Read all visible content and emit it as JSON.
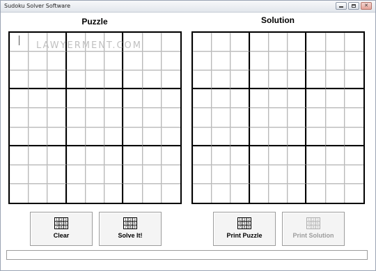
{
  "window": {
    "title": "Sudoku Solver Software",
    "controls": [
      "minimize-icon",
      "maximize-icon",
      "close-icon"
    ]
  },
  "puzzle": {
    "title": "Puzzle",
    "cells": [
      [
        "",
        "",
        "",
        "",
        "",
        "",
        "",
        "",
        ""
      ],
      [
        "",
        "",
        "",
        "",
        "",
        "",
        "",
        "",
        ""
      ],
      [
        "",
        "",
        "",
        "",
        "",
        "",
        "",
        "",
        ""
      ],
      [
        "",
        "",
        "",
        "",
        "",
        "",
        "",
        "",
        ""
      ],
      [
        "",
        "",
        "",
        "",
        "",
        "",
        "",
        "",
        ""
      ],
      [
        "",
        "",
        "",
        "",
        "",
        "",
        "",
        "",
        ""
      ],
      [
        "",
        "",
        "",
        "",
        "",
        "",
        "",
        "",
        ""
      ],
      [
        "",
        "",
        "",
        "",
        "",
        "",
        "",
        "",
        ""
      ],
      [
        "",
        "",
        "",
        "",
        "",
        "",
        "",
        "",
        ""
      ]
    ]
  },
  "solution": {
    "title": "Solution",
    "cells": [
      [
        "",
        "",
        "",
        "",
        "",
        "",
        "",
        "",
        ""
      ],
      [
        "",
        "",
        "",
        "",
        "",
        "",
        "",
        "",
        ""
      ],
      [
        "",
        "",
        "",
        "",
        "",
        "",
        "",
        "",
        ""
      ],
      [
        "",
        "",
        "",
        "",
        "",
        "",
        "",
        "",
        ""
      ],
      [
        "",
        "",
        "",
        "",
        "",
        "",
        "",
        "",
        ""
      ],
      [
        "",
        "",
        "",
        "",
        "",
        "",
        "",
        "",
        ""
      ],
      [
        "",
        "",
        "",
        "",
        "",
        "",
        "",
        "",
        ""
      ],
      [
        "",
        "",
        "",
        "",
        "",
        "",
        "",
        "",
        ""
      ],
      [
        "",
        "",
        "",
        "",
        "",
        "",
        "",
        "",
        ""
      ]
    ]
  },
  "watermark": "LAWYERMENT.COM",
  "buttons": {
    "clear": {
      "label": "Clear",
      "icon": "sudoku-grid-icon",
      "enabled": true
    },
    "solve": {
      "label": "Solve It!",
      "icon": "sudoku-grid-icon",
      "enabled": true
    },
    "print_puzzle": {
      "label": "Print Puzzle",
      "icon": "sudoku-grid-icon",
      "enabled": true
    },
    "print_solution": {
      "label": "Print Solution",
      "icon": "sudoku-grid-icon",
      "enabled": false
    }
  },
  "icon_digits": [
    "1",
    "2",
    "3",
    "4",
    "5",
    "6",
    "7",
    "8",
    "9"
  ],
  "status": {
    "text": ""
  },
  "colors": {
    "grid_major": "#000000",
    "grid_minor": "#b8b8b8",
    "disabled_text": "#9c9c9c"
  }
}
